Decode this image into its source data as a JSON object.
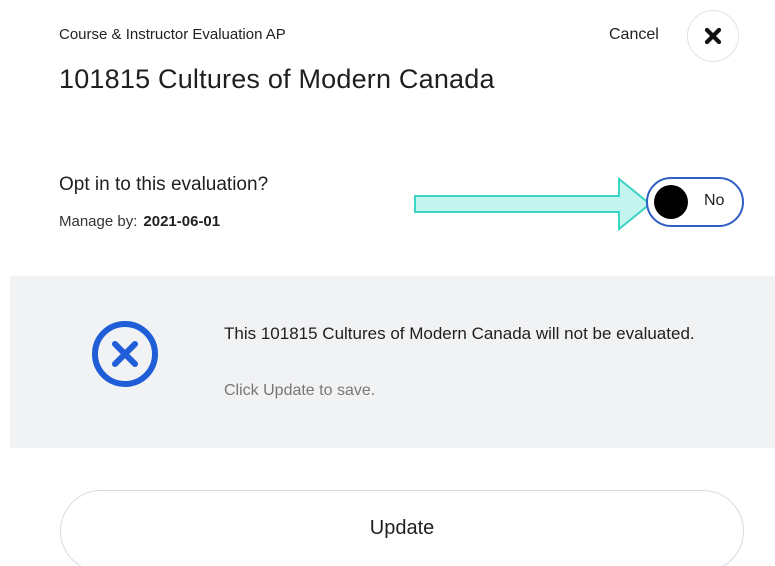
{
  "header": {
    "subtitle": "Course & Instructor Evaluation AP",
    "title": "101815 Cultures of Modern Canada",
    "cancel_label": "Cancel",
    "close_icon": "close-icon"
  },
  "opt_in": {
    "question": "Opt in to this evaluation?",
    "manage_label": "Manage by:",
    "manage_date": "2021-06-01",
    "toggle_state_label": "No",
    "toggle_on": false
  },
  "notice": {
    "icon": "x-circle-icon",
    "message": "This 101815 Cultures of Modern Canada will not be evaluated.",
    "hint": "Click Update to save."
  },
  "footer": {
    "update_label": "Update"
  },
  "colors": {
    "accent_blue": "#2f5fc4",
    "notice_background": "#f0f2f4",
    "annotation_arrow": "#3ad6c4"
  }
}
